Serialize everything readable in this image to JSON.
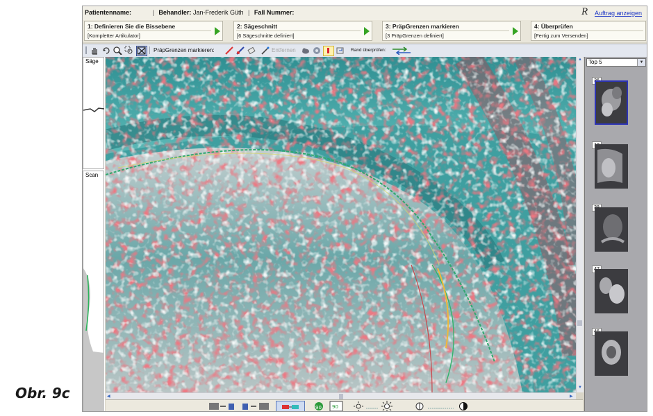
{
  "header": {
    "patient_label": "Patientenname:",
    "patient_value": "",
    "dentist_label": "Behandler:",
    "dentist_value": "Jan-Frederik Güth",
    "case_label": "Fall Nummer:",
    "case_value": "",
    "logo_text": "R",
    "order_link": "Auftrag anzeigen"
  },
  "steps": [
    {
      "title": "1: Definieren Sie die Bissebene",
      "status": "[Kompletter Artikulator]"
    },
    {
      "title": "2: Sägeschnitt",
      "status": "[6 Sägeschnitte definiert]"
    },
    {
      "title": "3: PräpGrenzen markieren",
      "status": "[3 PräpGrenzen definiert]"
    },
    {
      "title": "4: Überprüfen",
      "status": "[Fertig zum Versenden]"
    }
  ],
  "toolbar": {
    "prep_label": "PräpGrenzen markieren:",
    "remove_label": "Entfernen",
    "edge_check_label": "Rand überprüfen:"
  },
  "left_panel": {
    "saw_label": "Säge",
    "scan_label": "Scan"
  },
  "right_panel": {
    "dropdown_value": "Top 5",
    "thumbnails": [
      "36",
      "18",
      "38",
      "47",
      "46"
    ]
  },
  "caption": "Obr. 9c",
  "colors": {
    "accent_blue": "#2d34b5",
    "step_arrow": "#37a424",
    "link": "#1c36c6",
    "image_red": "#d8323e",
    "image_cyan": "#3fa3a2"
  }
}
